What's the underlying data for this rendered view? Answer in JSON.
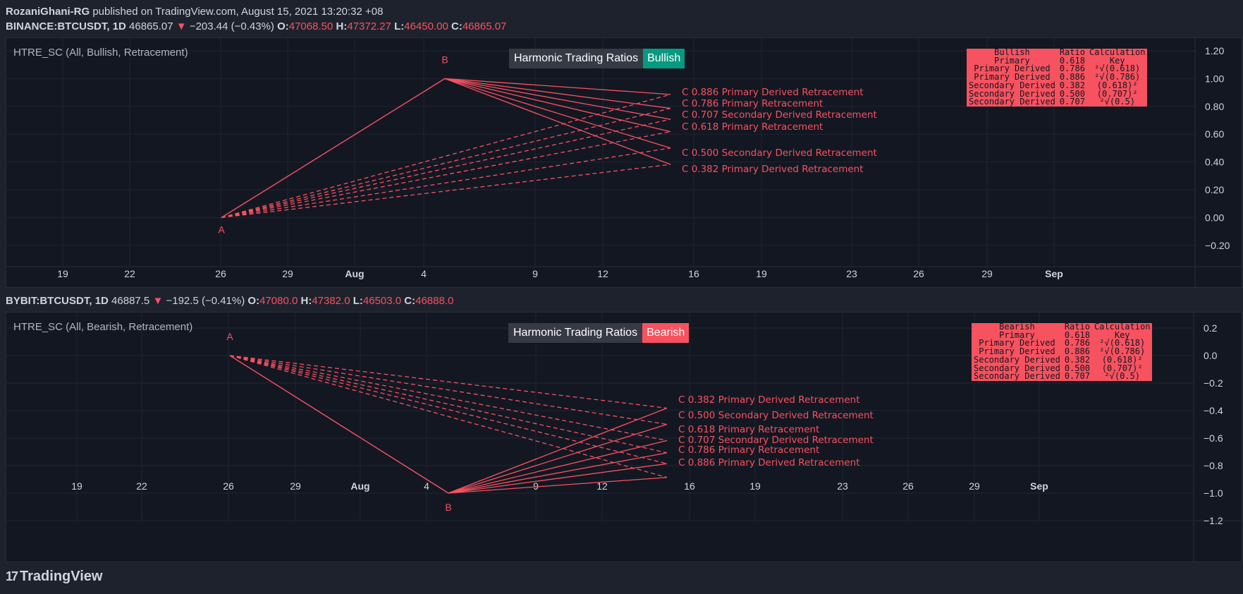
{
  "header": {
    "author": "RozaniGhani-RG",
    "published_text": "published on TradingView.com, August 15, 2021 13:20:32 +08"
  },
  "colors": {
    "background": "#1e222d",
    "panel": "#131722",
    "accent_red": "#f7525f",
    "bullish_teal": "#089981",
    "grid": "#2a2e39"
  },
  "panels": [
    {
      "symbol": "BINANCE:BTCUSDT",
      "interval": "1D",
      "price": "46865.07",
      "change": "−203.44 (−0.43%)",
      "o_label": "O:",
      "o": "47068.50",
      "h_label": "H:",
      "h": "47372.27",
      "l_label": "L:",
      "l": "46450.00",
      "c_label": "C:",
      "c": "46865.07",
      "indicator": "HTRE_SC (All, Bullish, Retracement)",
      "title": "Harmonic Trading Ratios",
      "bias": "Bullish",
      "bias_color": "#089981",
      "table": {
        "headers": [
          "Bullish",
          "Ratio",
          "Calculation"
        ],
        "rows": [
          [
            "Primary",
            "0.618",
            "Key"
          ],
          [
            "Primary Derived",
            "0.786",
            "²√(0.618)"
          ],
          [
            "Primary Derived",
            "0.886",
            "²√(0.786)"
          ],
          [
            "Secondary Derived",
            "0.382",
            "(0.618)²"
          ],
          [
            "Secondary Derived",
            "0.500",
            "(0.707)²"
          ],
          [
            "Secondary Derived",
            "0.707",
            "²√(0.5)"
          ]
        ]
      },
      "point_a": "A",
      "point_b": "B",
      "c_labels": [
        "C 0.886 Primary Derived Retracement",
        "C 0.786 Primary Retracement",
        "C 0.707 Secondary Derived Retracement",
        "C 0.618 Primary Retracement",
        "C 0.500 Secondary Derived Retracement",
        "C 0.382 Primary Derived Retracement"
      ],
      "chart_data": {
        "type": "line",
        "y_ticks": [
          "1.20",
          "1.00",
          "0.80",
          "0.60",
          "0.40",
          "0.20",
          "0.00",
          "−0.20"
        ],
        "ylim": [
          -0.2,
          1.2
        ],
        "x_ticks": [
          "19",
          "22",
          "26",
          "29",
          "Aug",
          "4",
          "9",
          "12",
          "16",
          "19",
          "23",
          "26",
          "29",
          "Sep"
        ],
        "a": {
          "x": "Jul 26",
          "y": 0.0
        },
        "b": {
          "x": "Aug 5",
          "y": 1.0
        },
        "c_levels": [
          0.886,
          0.786,
          0.707,
          0.618,
          0.5,
          0.382
        ]
      }
    },
    {
      "symbol": "BYBIT:BTCUSDT",
      "interval": "1D",
      "price": "46887.5",
      "change": "−192.5 (−0.41%)",
      "o_label": "O:",
      "o": "47080.0",
      "h_label": "H:",
      "h": "47382.0",
      "l_label": "L:",
      "l": "46503.0",
      "c_label": "C:",
      "c": "46888.0",
      "indicator": "HTRE_SC (All, Bearish, Retracement)",
      "title": "Harmonic Trading Ratios",
      "bias": "Bearish",
      "bias_color": "#f7525f",
      "table": {
        "headers": [
          "Bearish",
          "Ratio",
          "Calculation"
        ],
        "rows": [
          [
            "Primary",
            "0.618",
            "Key"
          ],
          [
            "Primary Derived",
            "0.786",
            "²√(0.618)"
          ],
          [
            "Primary Derived",
            "0.886",
            "²√(0.786)"
          ],
          [
            "Secondary Derived",
            "0.382",
            "(0.618)²"
          ],
          [
            "Secondary Derived",
            "0.500",
            "(0.707)²"
          ],
          [
            "Secondary Derived",
            "0.707",
            "²√(0.5)"
          ]
        ]
      },
      "point_a": "A",
      "point_b": "B",
      "c_labels": [
        "C 0.382 Primary Derived Retracement",
        "C 0.500 Secondary Derived Retracement",
        "C 0.618 Primary Retracement",
        "C 0.707 Secondary Derived Retracement",
        "C 0.786 Primary Retracement",
        "C 0.886 Primary Derived Retracement"
      ],
      "chart_data": {
        "type": "line",
        "y_ticks": [
          "0.2",
          "0.0",
          "−0.2",
          "−0.4",
          "−0.6",
          "−0.8",
          "−1.0",
          "−1.2"
        ],
        "ylim": [
          -1.3,
          0.3
        ],
        "x_ticks": [
          "19",
          "22",
          "26",
          "29",
          "Aug",
          "4",
          "9",
          "12",
          "16",
          "19",
          "23",
          "26",
          "29",
          "Sep"
        ],
        "a": {
          "x": "Jul 26",
          "y": 0.0
        },
        "b": {
          "x": "Aug 5",
          "y": -1.0
        },
        "c_levels": [
          -0.382,
          -0.5,
          -0.618,
          -0.707,
          -0.786,
          -0.886
        ]
      }
    }
  ],
  "brand": {
    "name": "TradingView",
    "logo": "17"
  }
}
